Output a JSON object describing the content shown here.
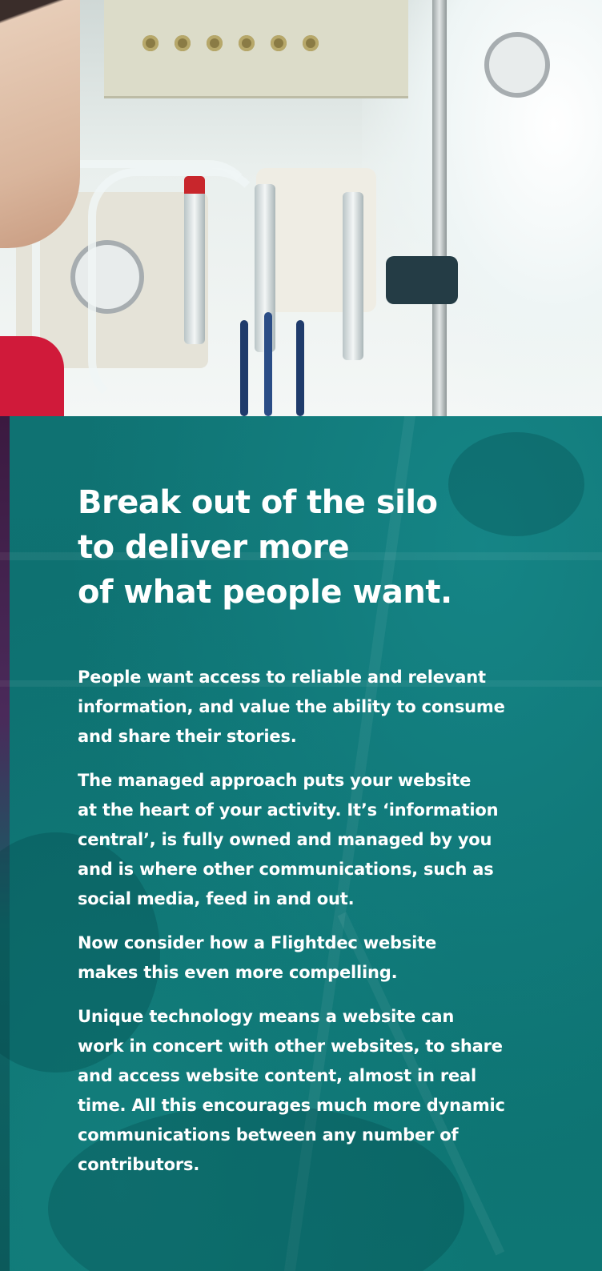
{
  "headline": {
    "lines": [
      "Break out of the silo",
      "to deliver more",
      "of what people want."
    ]
  },
  "paragraphs": [
    {
      "lines": [
        "People want access to reliable and relevant",
        "information, and value the ability to consume",
        "and share their stories."
      ]
    },
    {
      "lines": [
        "The managed approach puts your website",
        "at the heart of your activity. It’s ‘information",
        "central’, is fully owned and managed by you",
        "and is where other communications, such as",
        "social media, feed in and out."
      ]
    },
    {
      "lines": [
        "Now consider how a Flightdec website",
        "makes this even more compelling."
      ]
    },
    {
      "lines": [
        "Unique technology means a website can",
        "work in concert with other websites, to share",
        "and access website content, almost in real",
        "time. All this encourages much more dynamic",
        "communications between any number of",
        "contributors."
      ]
    }
  ],
  "colors": {
    "panel": "#0c6f70",
    "text": "#ffffff"
  }
}
